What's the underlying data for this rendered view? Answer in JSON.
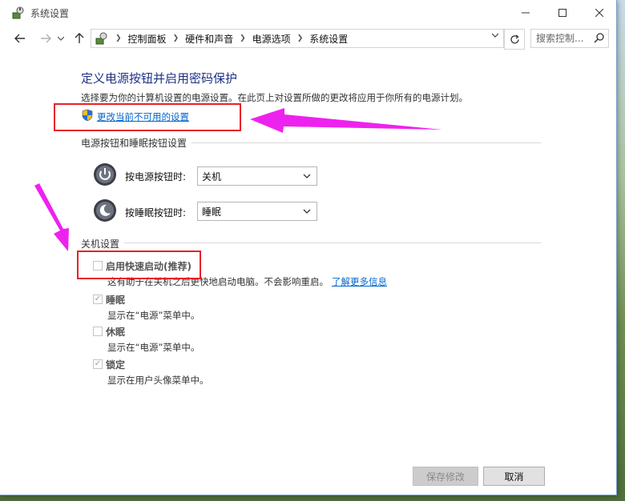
{
  "window": {
    "title": "系统设置"
  },
  "nav": {
    "breadcrumbs": [
      "控制面板",
      "硬件和声音",
      "电源选项",
      "系统设置"
    ],
    "search_placeholder": "搜索控制...",
    "refresh_icon": "refresh-icon"
  },
  "page": {
    "title": "定义电源按钮并启用密码保护",
    "description": "选择要为你的计算机设置的电源设置。在此页上对设置所做的更改将应用于你所有的电源计划。",
    "change_link": "更改当前不可用的设置"
  },
  "power_buttons": {
    "group_label": "电源按钮和睡眠按钮设置",
    "power_label": "按电源按钮时:",
    "power_value": "关机",
    "sleep_label": "按睡眠按钮时:",
    "sleep_value": "睡眠"
  },
  "shutdown": {
    "group_label": "关机设置",
    "items": [
      {
        "label": "启用快速启动(推荐)",
        "checked": false,
        "desc": "这有助于在关机之后更快地启动电脑。不会影响重启。",
        "link": "了解更多信息"
      },
      {
        "label": "睡眠",
        "checked": true,
        "desc": "显示在“电源”菜单中。"
      },
      {
        "label": "休眠",
        "checked": false,
        "desc": "显示在“电源”菜单中。"
      },
      {
        "label": "锁定",
        "checked": true,
        "desc": "显示在用户头像菜单中。"
      }
    ]
  },
  "footer": {
    "save_label": "保存修改",
    "cancel_label": "取消"
  },
  "colors": {
    "annotation_red": "#e8202a",
    "annotation_arrow": "#ee22ee",
    "link": "#0066cc",
    "title": "#1e3287"
  }
}
